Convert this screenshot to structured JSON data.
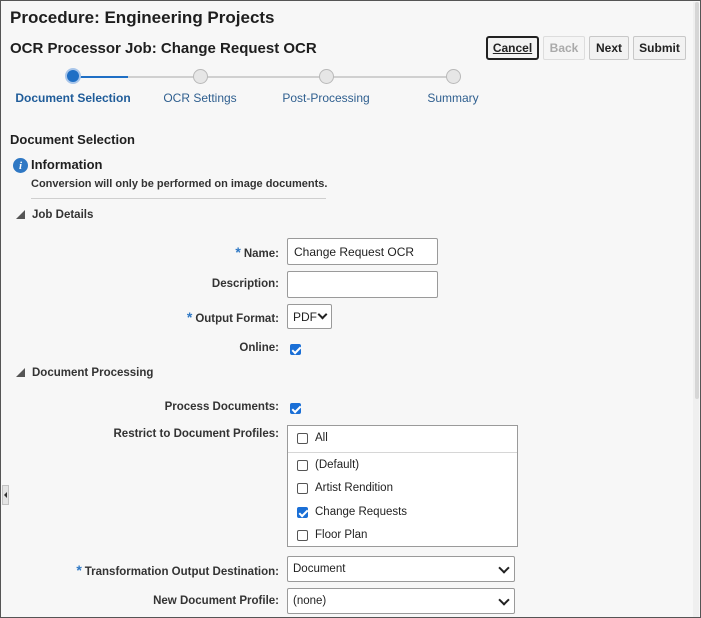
{
  "header": {
    "procedure_title": "Procedure: Engineering Projects",
    "job_title": "OCR Processor Job: Change Request OCR"
  },
  "toolbar": {
    "cancel_label": "Cancel",
    "back_label": "Back",
    "next_label": "Next",
    "submit_label": "Submit"
  },
  "train": {
    "steps": [
      {
        "label": "Document Selection",
        "state": "active"
      },
      {
        "label": "OCR Settings",
        "state": "pending"
      },
      {
        "label": "Post-Processing",
        "state": "pending"
      },
      {
        "label": "Summary",
        "state": "pending"
      }
    ]
  },
  "section": {
    "title": "Document Selection"
  },
  "info": {
    "icon": "info-icon",
    "title": "Information",
    "text": "Conversion will only be performed on image documents."
  },
  "job_details": {
    "title": "Job Details",
    "name_label": "Name:",
    "name_value": "Change Request OCR",
    "description_label": "Description:",
    "description_value": "",
    "output_format_label": "Output Format:",
    "output_format_value": "PDF",
    "online_label": "Online:",
    "online_checked": true
  },
  "document_processing": {
    "title": "Document Processing",
    "process_documents_label": "Process Documents:",
    "process_documents_checked": true,
    "restrict_profiles_label": "Restrict to Document Profiles:",
    "profiles": [
      {
        "label": "All",
        "checked": false
      },
      {
        "label": "(Default)",
        "checked": false
      },
      {
        "label": "Artist Rendition",
        "checked": false
      },
      {
        "label": "Change Requests",
        "checked": true
      },
      {
        "label": "Floor Plan",
        "checked": false
      }
    ],
    "destination_label": "Transformation Output Destination:",
    "destination_value": "Document",
    "new_profile_label": "New Document Profile:",
    "new_profile_value": "(none)"
  },
  "required_marker": "*",
  "colors": {
    "accent": "#1f6fc5",
    "checkbox": "#1a6fd6",
    "required": "#2f78c4"
  }
}
